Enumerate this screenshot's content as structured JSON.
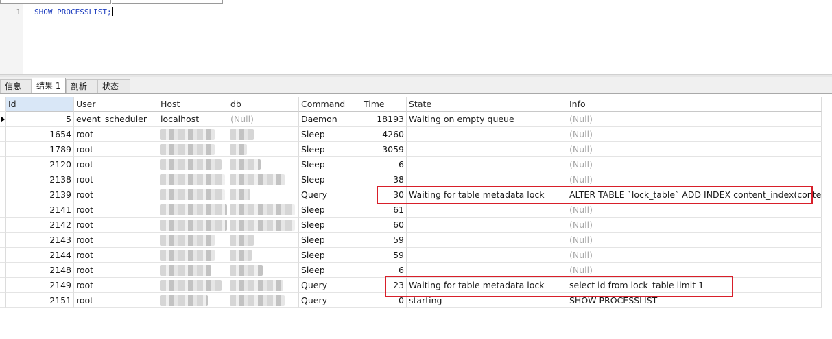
{
  "editor": {
    "line_number": "1",
    "query": "SHOW PROCESSLIST;"
  },
  "result_tabs": [
    {
      "label": "信息",
      "active": false
    },
    {
      "label": "结果 1",
      "active": true
    },
    {
      "label": "剖析",
      "active": false
    },
    {
      "label": "状态",
      "active": false
    }
  ],
  "table": {
    "columns": [
      "Id",
      "User",
      "Host",
      "db",
      "Command",
      "Time",
      "State",
      "Info"
    ],
    "rows": [
      {
        "id": "5",
        "user": "event_scheduler",
        "host": "localhost",
        "db": "(Null)",
        "command": "Daemon",
        "time": "18193",
        "state": "Waiting on empty queue",
        "info": "(Null)"
      },
      {
        "id": "1654",
        "user": "root",
        "host": "",
        "db": "",
        "command": "Sleep",
        "time": "4260",
        "state": "",
        "info": "(Null)"
      },
      {
        "id": "1789",
        "user": "root",
        "host": "",
        "db": "",
        "command": "Sleep",
        "time": "3059",
        "state": "",
        "info": "(Null)"
      },
      {
        "id": "2120",
        "user": "root",
        "host": "",
        "db": "",
        "command": "Sleep",
        "time": "6",
        "state": "",
        "info": "(Null)"
      },
      {
        "id": "2138",
        "user": "root",
        "host": "",
        "db": "",
        "command": "Sleep",
        "time": "38",
        "state": "",
        "info": "(Null)"
      },
      {
        "id": "2139",
        "user": "root",
        "host": "",
        "db": "",
        "command": "Query",
        "time": "30",
        "state": "Waiting for table metadata lock",
        "info": "ALTER TABLE `lock_table` ADD INDEX content_index(content)"
      },
      {
        "id": "2141",
        "user": "root",
        "host": "",
        "db": "",
        "command": "Sleep",
        "time": "61",
        "state": "",
        "info": "(Null)"
      },
      {
        "id": "2142",
        "user": "root",
        "host": "",
        "db": "",
        "command": "Sleep",
        "time": "60",
        "state": "",
        "info": "(Null)"
      },
      {
        "id": "2143",
        "user": "root",
        "host": "",
        "db": "",
        "command": "Sleep",
        "time": "59",
        "state": "",
        "info": "(Null)"
      },
      {
        "id": "2144",
        "user": "root",
        "host": "",
        "db": "",
        "command": "Sleep",
        "time": "59",
        "state": "",
        "info": "(Null)"
      },
      {
        "id": "2148",
        "user": "root",
        "host": "",
        "db": "",
        "command": "Sleep",
        "time": "6",
        "state": "",
        "info": "(Null)"
      },
      {
        "id": "2149",
        "user": "root",
        "host": "",
        "db": "",
        "command": "Query",
        "time": "23",
        "state": "Waiting for table metadata lock",
        "info": "select id from lock_table limit 1"
      },
      {
        "id": "2151",
        "user": "root",
        "host": "",
        "db": "",
        "command": "Query",
        "time": "0",
        "state": "starting",
        "info": "SHOW PROCESSLIST"
      }
    ]
  },
  "colors": {
    "highlight": "#d81f2a",
    "null_text": "#a8a8a8",
    "sql_keyword": "#1f3fbf"
  }
}
